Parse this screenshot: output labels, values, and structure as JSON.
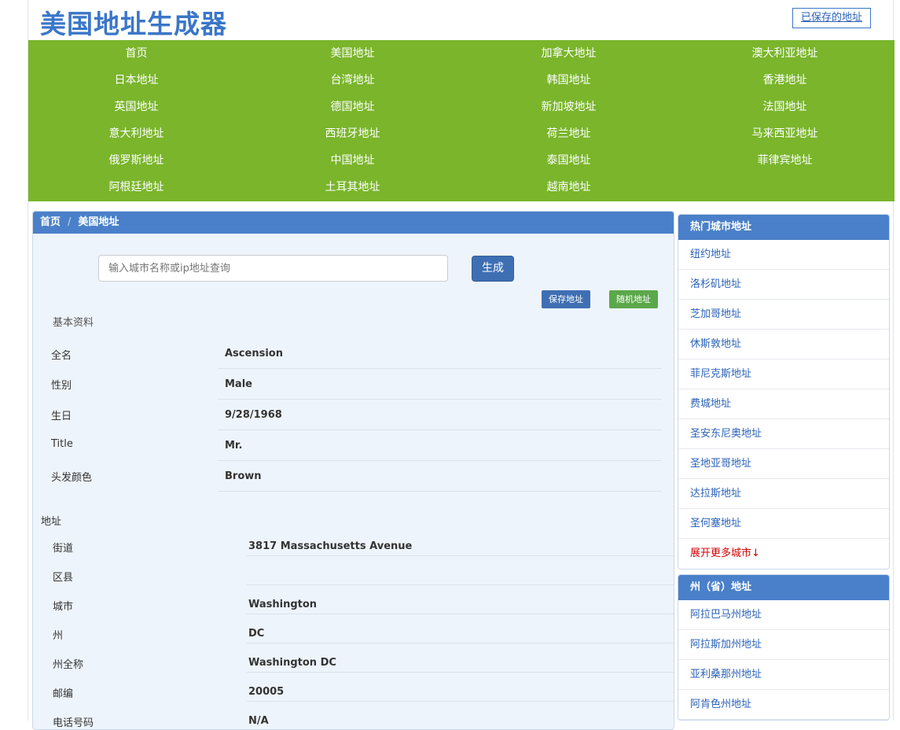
{
  "header": {
    "title": "美国地址生成器",
    "saved_link": "已保存的地址"
  },
  "nav": [
    [
      "首页",
      "美国地址",
      "加拿大地址",
      "澳大利亚地址"
    ],
    [
      "日本地址",
      "台湾地址",
      "韩国地址",
      "香港地址"
    ],
    [
      "英国地址",
      "德国地址",
      "新加坡地址",
      "法国地址"
    ],
    [
      "意大利地址",
      "西班牙地址",
      "荷兰地址",
      "马来西亚地址"
    ],
    [
      "俄罗斯地址",
      "中国地址",
      "泰国地址",
      "菲律宾地址"
    ],
    [
      "阿根廷地址",
      "土耳其地址",
      "越南地址",
      ""
    ]
  ],
  "breadcrumb": {
    "home": "首页",
    "separator": "/",
    "current": "美国地址"
  },
  "search": {
    "placeholder": "输入城市名称或ip地址查询",
    "generate": "生成",
    "save": "保存地址",
    "random": "随机地址"
  },
  "basic": {
    "title": "基本资料",
    "rows": [
      {
        "label": "全名",
        "value": "Ascension"
      },
      {
        "label": "性别",
        "value": "Male"
      },
      {
        "label": "生日",
        "value": "9/28/1968"
      },
      {
        "label": "Title",
        "value": "Mr."
      },
      {
        "label": "头发颜色",
        "value": "Brown"
      }
    ]
  },
  "address": {
    "title": "地址",
    "rows": [
      {
        "label": "街道",
        "value": "3817  Massachusetts Avenue"
      },
      {
        "label": "区县",
        "value": ""
      },
      {
        "label": "城市",
        "value": "Washington"
      },
      {
        "label": "州",
        "value": "DC"
      },
      {
        "label": "州全称",
        "value": "Washington DC"
      },
      {
        "label": "邮编",
        "value": "20005"
      },
      {
        "label": "电话号码",
        "value": "N/A"
      }
    ]
  },
  "hot_cities": {
    "title": "热门城市地址",
    "items": [
      "纽约地址",
      "洛杉矶地址",
      "芝加哥地址",
      "休斯敦地址",
      "菲尼克斯地址",
      "费城地址",
      "圣安东尼奥地址",
      "圣地亚哥地址",
      "达拉斯地址",
      "圣何塞地址"
    ],
    "more": "展开更多城市↓"
  },
  "states": {
    "title": "州（省）地址",
    "items": [
      "阿拉巴马州地址",
      "阿拉斯加州地址",
      "亚利桑那州地址",
      "阿肯色州地址"
    ]
  },
  "colors": {
    "nav_green": "#7ab52b",
    "header_blue": "#4a80c9",
    "link_blue": "#2a62b8",
    "more_red": "#d00000"
  }
}
